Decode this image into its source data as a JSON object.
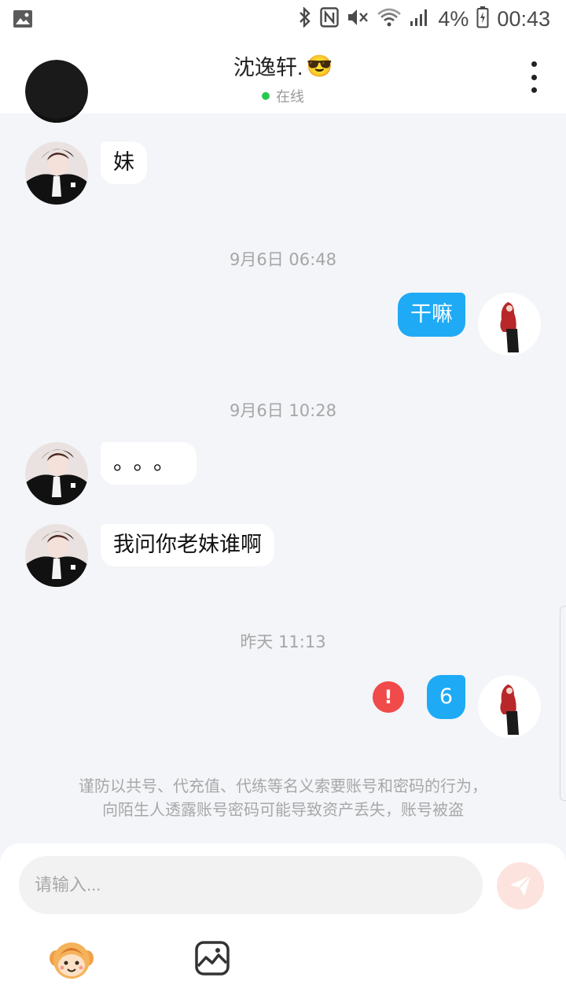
{
  "status_bar": {
    "battery": "4%",
    "time": "00:43"
  },
  "header": {
    "title": "沈逸轩.",
    "title_emoji": "😎",
    "status": "在线"
  },
  "messages": {
    "msg1": "妹",
    "ts1": "9月6日 06:48",
    "msg2": "干嘛",
    "ts2": "9月6日 10:28",
    "msg3": "。。。",
    "msg4": "我问你老妹谁啊",
    "ts3": "昨天 11:13",
    "msg5": "6",
    "error_mark": "!"
  },
  "warning": {
    "line1": "谨防以共号、代充值、代练等名义索要账号和密码的行为，",
    "line2": "向陌生人透露账号密码可能导致资产丢失，账号被盗"
  },
  "composer": {
    "placeholder": "请输入..."
  },
  "colors": {
    "outgoing_bubble": "#1eaaf5",
    "online": "#2ac850",
    "error": "#f04a4a"
  },
  "icons": [
    "back-icon",
    "more-icon",
    "send-icon",
    "emoji-icon",
    "image-icon",
    "gallery-icon",
    "bluetooth-icon",
    "nfc-icon",
    "mute-icon",
    "wifi-icon",
    "signal-icon",
    "battery-icon"
  ]
}
